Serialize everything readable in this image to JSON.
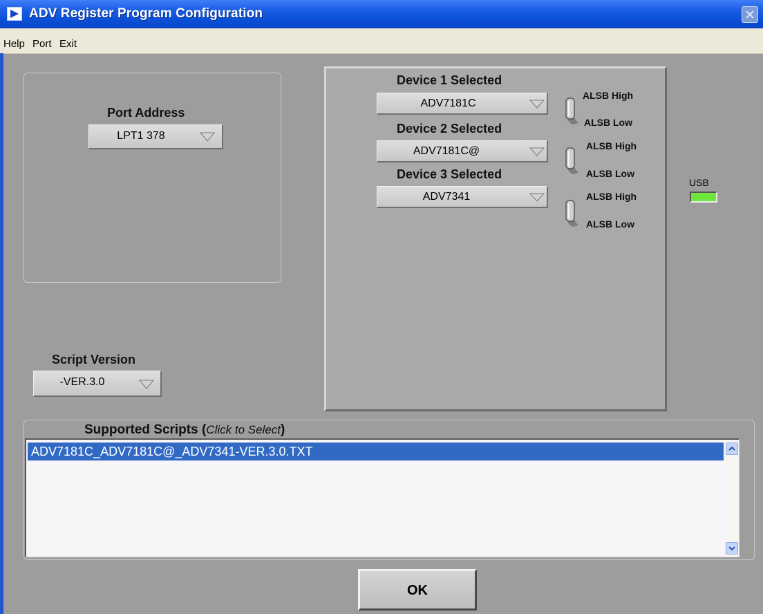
{
  "window": {
    "title": "ADV Register Program Configuration"
  },
  "menu": [
    "Help",
    "Port",
    "Exit"
  ],
  "port": {
    "label": "Port Address",
    "value": "LPT1 378"
  },
  "script_version": {
    "label": "Script Version",
    "value": "-VER.3.0"
  },
  "devices": [
    {
      "label": "Device 1 Selected",
      "value": "ADV7181C",
      "toggle_high": "ALSB High",
      "toggle_low": "ALSB Low"
    },
    {
      "label": "Device 2 Selected",
      "value": "ADV7181C@",
      "toggle_high": "ALSB High",
      "toggle_low": "ALSB Low"
    },
    {
      "label": "Device 3 Selected",
      "value": "ADV7341",
      "toggle_high": "ALSB High",
      "toggle_low": "ALSB Low"
    }
  ],
  "usb": {
    "label": "USB",
    "led_color": "#6fe63a"
  },
  "scripts": {
    "title": "Supported Scripts (",
    "title_hint": "Click to Select",
    "title_close": ")",
    "items": [
      "ADV7181C_ADV7181C@_ADV7341-VER.3.0.TXT"
    ],
    "selected_color": "#316ac5"
  },
  "ok_label": "OK"
}
